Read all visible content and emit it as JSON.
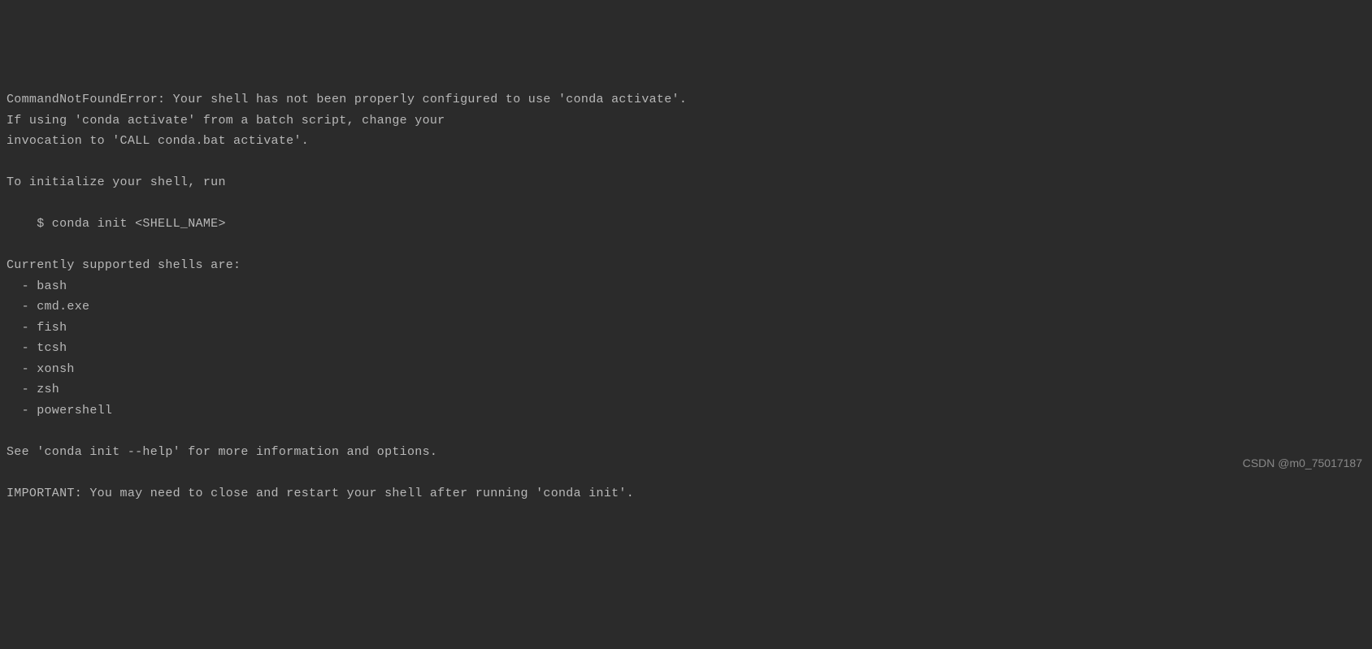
{
  "terminal": {
    "lines": {
      "l0": "CommandNotFoundError: Your shell has not been properly configured to use 'conda activate'.",
      "l1": "If using 'conda activate' from a batch script, change your",
      "l2": "invocation to 'CALL conda.bat activate'.",
      "l3": "",
      "l4": "To initialize your shell, run",
      "l5": "",
      "l6": "    $ conda init <SHELL_NAME>",
      "l7": "",
      "l8": "Currently supported shells are:",
      "l9": "  - bash",
      "l10": "  - cmd.exe",
      "l11": "  - fish",
      "l12": "  - tcsh",
      "l13": "  - xonsh",
      "l14": "  - zsh",
      "l15": "  - powershell",
      "l16": "",
      "l17": "See 'conda init --help' for more information and options.",
      "l18": "",
      "l19": "IMPORTANT: You may need to close and restart your shell after running 'conda init'."
    }
  },
  "watermark": "CSDN @m0_75017187"
}
